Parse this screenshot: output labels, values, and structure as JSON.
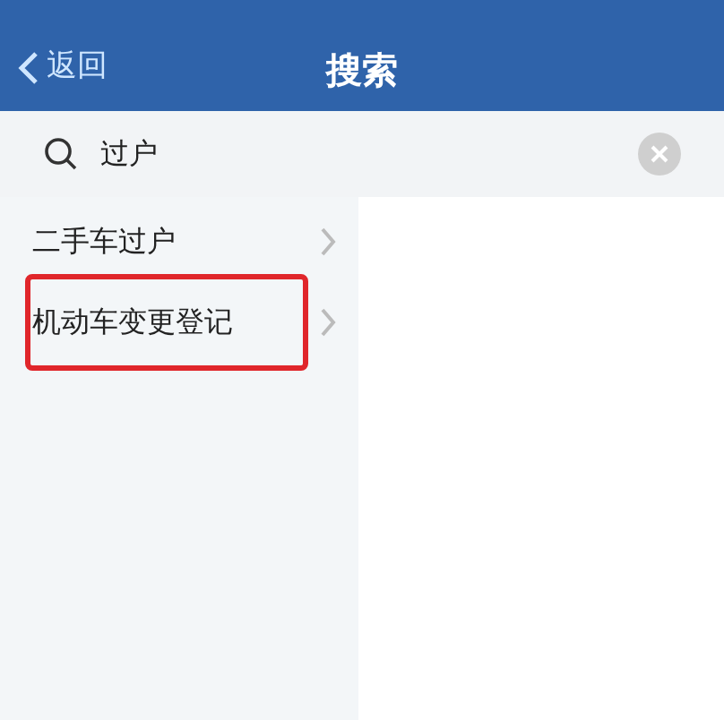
{
  "header": {
    "back_label": "返回",
    "title": "搜索"
  },
  "search": {
    "value": "过户"
  },
  "results": [
    {
      "label": "二手车过户",
      "highlighted": false
    },
    {
      "label": "机动车变更登记",
      "highlighted": true
    }
  ]
}
